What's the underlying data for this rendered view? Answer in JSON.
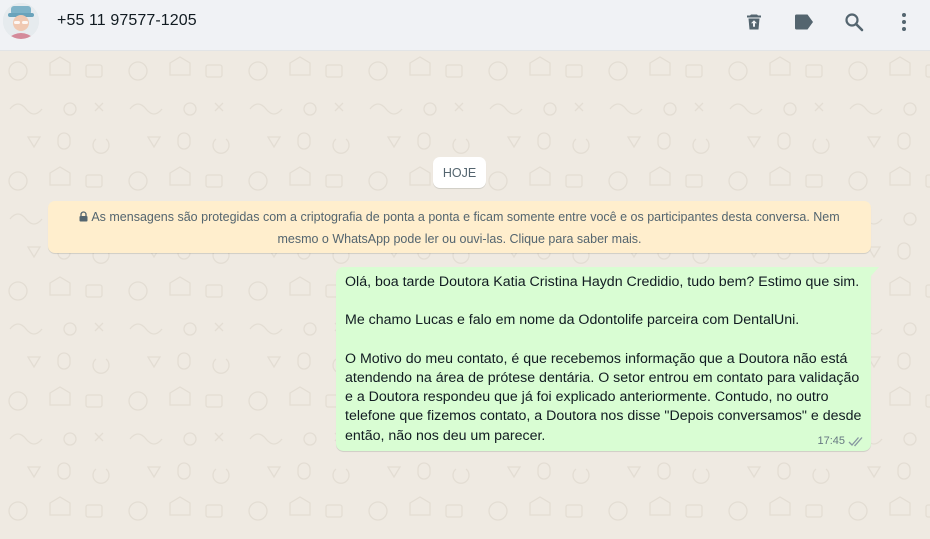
{
  "header": {
    "contact_name": "+55 11 97577-1205",
    "actions": [
      {
        "icon": "delete-icon"
      },
      {
        "icon": "label-icon"
      },
      {
        "icon": "search-icon"
      },
      {
        "icon": "menu-icon"
      }
    ]
  },
  "chat": {
    "date_chip": "HOJE",
    "encryption_notice": "As mensagens são protegidas com a criptografia de ponta a ponta e ficam somente entre você e os participantes desta conversa. Nem mesmo o WhatsApp pode ler ou ouvi-las. Clique para saber mais.",
    "messages": [
      {
        "direction": "outgoing",
        "text": "Olá, boa tarde Doutora Katia Cristina Haydn Credidio, tudo bem? Estimo que sim.\n\nMe chamo Lucas e falo em nome da Odontolife parceira com DentalUni.\n\nO Motivo do meu contato, é que recebemos informação que a Doutora não está atendendo na área de prótese dentária. O setor entrou em contato para validação e a Doutora respondeu que já foi explicado anteriormente. Contudo, no outro telefone que fizemos contato, a Doutora nos disse \"Depois conversamos\" e desde então, não nos deu um parecer.",
        "time": "17:45",
        "status": "read"
      }
    ]
  },
  "colors": {
    "header_bg": "#f0f2f5",
    "chat_bg": "#efeae2",
    "outgoing_bubble": "#d9fdd3",
    "notice_bg": "#ffeecd",
    "icon": "#54656f",
    "read_ticks": "#8696a0"
  }
}
